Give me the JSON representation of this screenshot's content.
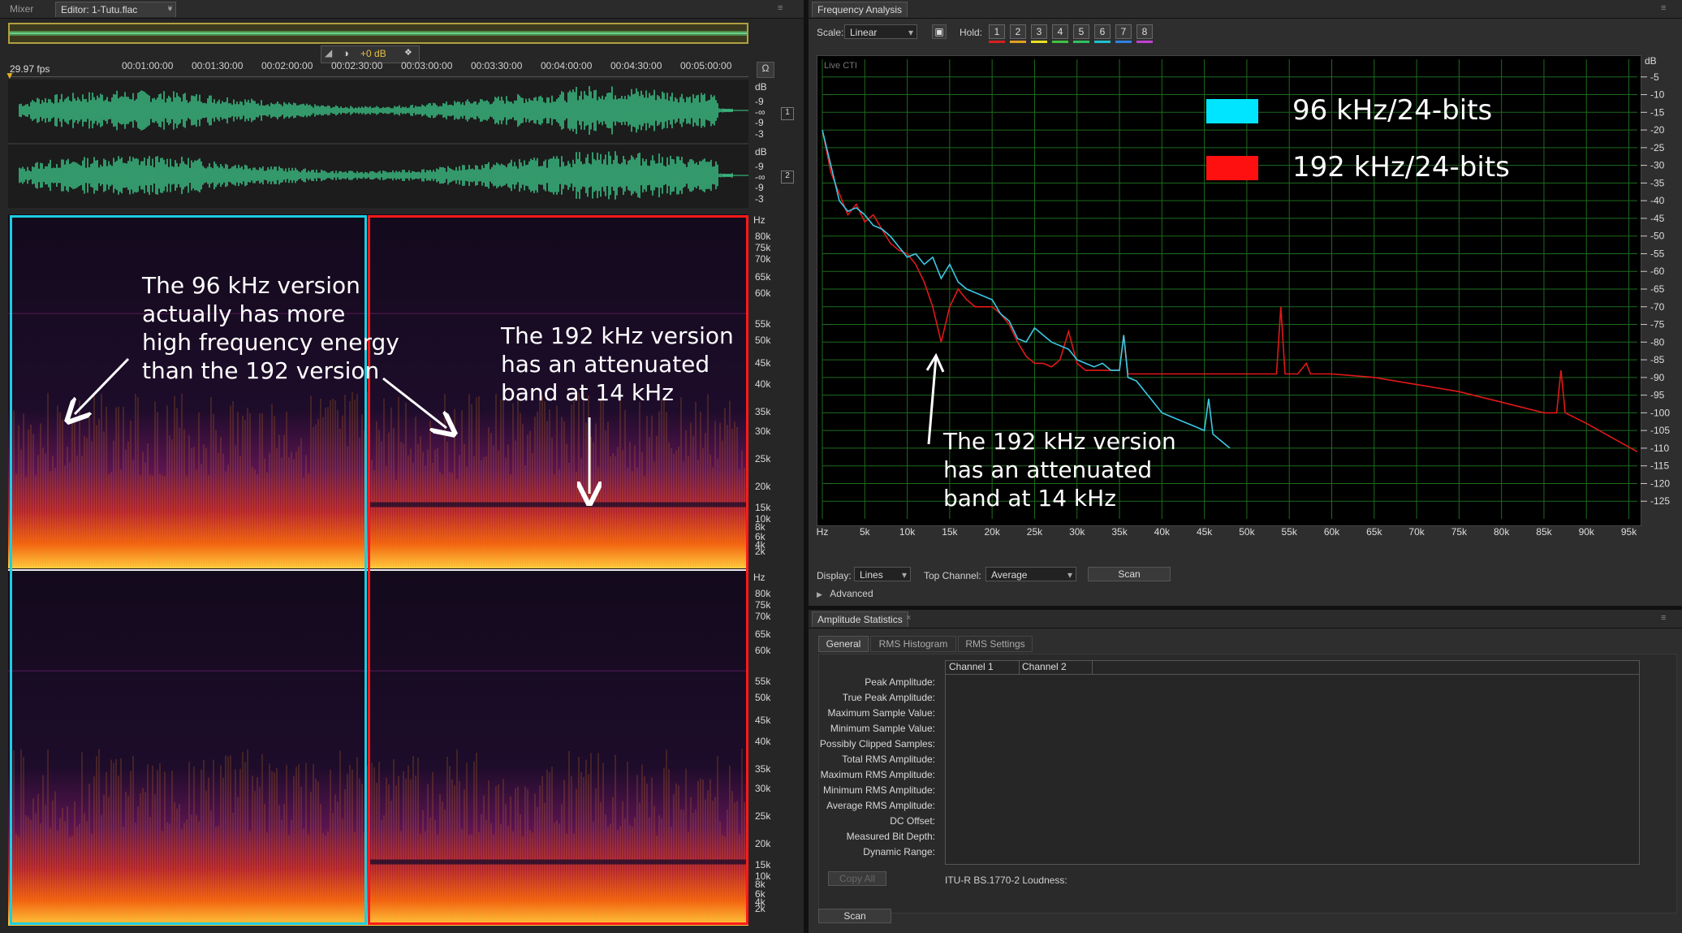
{
  "editor": {
    "tabs": {
      "mixer": "Mixer",
      "editor": "Editor: 1-Tutu.flac"
    },
    "fps": "29.97 fps",
    "gain": "+0 dB",
    "ruler": [
      "00:01:00:00",
      "00:01:30:00",
      "00:02:00:00",
      "00:02:30:00",
      "00:03:00:00",
      "00:03:30:00",
      "00:04:00:00",
      "00:04:30:00",
      "00:05:00:00"
    ],
    "db_scale": [
      "dB",
      "-9",
      "-∞",
      "-9",
      "-3"
    ],
    "channels": [
      "1",
      "2"
    ],
    "hz_label": "Hz",
    "hz_scale": [
      "80k",
      "75k",
      "70k",
      "65k",
      "60k",
      "55k",
      "50k",
      "45k",
      "40k",
      "35k",
      "30k",
      "25k",
      "20k",
      "15k",
      "10k",
      "8k",
      "6k",
      "4k",
      "2k"
    ]
  },
  "annotations": {
    "left_96": "The 96 kHz version\nactually has more\nhigh frequency energy\nthan the 192 version",
    "right_192": "The 192 kHz version\nhas an attenuated\nband at 14 kHz",
    "chart_192": "The 192 kHz version\nhas an attenuated\nband at 14 kHz"
  },
  "freq": {
    "title": "Frequency Analysis",
    "scale_label": "Scale:",
    "scale_value": "Linear",
    "hold_label": "Hold:",
    "holds": [
      "1",
      "2",
      "3",
      "4",
      "5",
      "6",
      "7",
      "8"
    ],
    "hold_colors": [
      "#d62020",
      "#e0a020",
      "#e8e020",
      "#40c040",
      "#30c060",
      "#20c0d0",
      "#3080e0",
      "#c040d0"
    ],
    "live_label": "Live CTI",
    "display_label": "Display:",
    "display_value": "Lines",
    "top_channel_label": "Top Channel:",
    "top_channel_value": "Average",
    "scan": "Scan",
    "advanced": "Advanced"
  },
  "chart_data": {
    "type": "line",
    "xlabel": "",
    "ylabel": "dB",
    "x_ticks": [
      "Hz",
      "5k",
      "10k",
      "15k",
      "20k",
      "25k",
      "30k",
      "35k",
      "40k",
      "45k",
      "50k",
      "55k",
      "60k",
      "65k",
      "70k",
      "75k",
      "80k",
      "85k",
      "90k",
      "95k"
    ],
    "y_ticks": [
      "-5",
      "-10",
      "-15",
      "-20",
      "-25",
      "-30",
      "-35",
      "-40",
      "-45",
      "-50",
      "-55",
      "-60",
      "-65",
      "-70",
      "-75",
      "-80",
      "-85",
      "-90",
      "-95",
      "-100",
      "-105",
      "-110",
      "-115",
      "-120",
      "-125"
    ],
    "xlim": [
      0,
      96000
    ],
    "ylim": [
      -130,
      0
    ],
    "grid": true,
    "legend": [
      {
        "name": "96 kHz/24-bits",
        "color": "#00e5ff"
      },
      {
        "name": "192 kHz/24-bits",
        "color": "#ff1010"
      }
    ],
    "series": [
      {
        "name": "96 kHz/24-bits",
        "color": "#3cc8e6",
        "x": [
          0,
          1000,
          2000,
          3000,
          4000,
          5000,
          6000,
          7000,
          8000,
          9000,
          10000,
          11000,
          12000,
          13000,
          14000,
          15000,
          16000,
          17000,
          18000,
          19000,
          20000,
          21000,
          22000,
          23000,
          24000,
          25000,
          26000,
          27000,
          28000,
          29000,
          30000,
          31000,
          32000,
          33000,
          34000,
          35000,
          35500,
          36000,
          37000,
          38000,
          39000,
          40000,
          41000,
          42000,
          43000,
          44000,
          45000,
          45500,
          46000,
          47000,
          48000
        ],
        "y": [
          -20,
          -30,
          -40,
          -43,
          -42,
          -44,
          -47,
          -48,
          -50,
          -53,
          -56,
          -55,
          -58,
          -56,
          -62,
          -58,
          -63,
          -65,
          -66,
          -67,
          -68,
          -72,
          -74,
          -79,
          -80,
          -76,
          -78,
          -80,
          -81,
          -82,
          -85,
          -86,
          -87,
          -86,
          -88,
          -88,
          -78,
          -90,
          -91,
          -94,
          -97,
          -100,
          -101,
          -102,
          -103,
          -104,
          -105,
          -96,
          -106,
          -108,
          -110
        ]
      },
      {
        "name": "192 kHz/24-bits",
        "color": "#e01818",
        "x": [
          0,
          1000,
          2000,
          3000,
          4000,
          5000,
          6000,
          7000,
          8000,
          9000,
          10000,
          11000,
          12000,
          13000,
          14000,
          15000,
          16000,
          17000,
          18000,
          19000,
          20000,
          21000,
          22000,
          23000,
          24000,
          25000,
          26000,
          27000,
          28000,
          29000,
          30000,
          31000,
          32000,
          33000,
          34000,
          35000,
          35500,
          36000,
          38000,
          40000,
          45000,
          50000,
          53500,
          54000,
          54500,
          56000,
          57000,
          57500,
          58000,
          60000,
          65000,
          70000,
          75000,
          80000,
          85000,
          86500,
          87000,
          87500,
          90000,
          93000,
          96000
        ],
        "y": [
          -20,
          -32,
          -38,
          -44,
          -41,
          -46,
          -44,
          -48,
          -52,
          -54,
          -55,
          -58,
          -63,
          -70,
          -80,
          -70,
          -65,
          -68,
          -70,
          -70,
          -70,
          -72,
          -75,
          -80,
          -84,
          -86,
          -86,
          -87,
          -85,
          -77,
          -86,
          -88,
          -88,
          -88,
          -88,
          -88,
          -78,
          -89,
          -89,
          -89,
          -89,
          -89,
          -89,
          -70,
          -89,
          -89,
          -86,
          -89,
          -89,
          -89,
          -90,
          -92,
          -94,
          -97,
          -100,
          -100,
          -88,
          -100,
          -103,
          -107,
          -111
        ]
      }
    ]
  },
  "amp": {
    "title": "Amplitude Statistics",
    "tabs": [
      "General",
      "RMS Histogram",
      "RMS Settings"
    ],
    "columns": [
      "Channel 1",
      "Channel 2"
    ],
    "rows": [
      "Peak Amplitude:",
      "True Peak Amplitude:",
      "Maximum Sample Value:",
      "Minimum Sample Value:",
      "Possibly Clipped Samples:",
      "Total RMS Amplitude:",
      "Maximum RMS Amplitude:",
      "Minimum RMS Amplitude:",
      "Average RMS Amplitude:",
      "DC Offset:",
      "Measured Bit Depth:",
      "Dynamic Range:"
    ],
    "copy_all": "Copy All",
    "loudness": "ITU-R BS.1770-2 Loudness:",
    "scan": "Scan"
  }
}
